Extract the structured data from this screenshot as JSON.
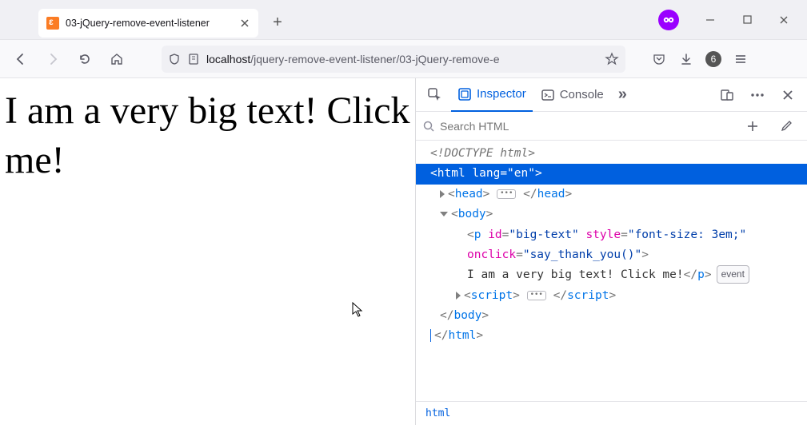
{
  "window": {
    "tab_title": "03-jQuery-remove-event-listener",
    "minimize": "—",
    "maximize": "☐",
    "close": "✕",
    "newtab_plus": "+"
  },
  "toolbar": {
    "url_host": "localhost",
    "url_path": "/jquery-remove-event-listener/03-jQuery-remove-e",
    "badge_count": "6"
  },
  "page": {
    "big_text": "I am a very big text! Click me!"
  },
  "devtools": {
    "tab_inspector": "Inspector",
    "tab_console": "Console",
    "more": "»",
    "search_placeholder": "Search HTML",
    "breadcrumb": "html",
    "tree": {
      "doctype": "<!DOCTYPE html>",
      "html_open": "<html lang=\"en\">",
      "head": "head",
      "body": "body",
      "p_id_attr": "id",
      "p_id_val": "\"big-text\"",
      "p_style_attr": "style",
      "p_style_val": "\"font-size: 3em;\"",
      "p_onclick_attr": "onclick",
      "p_onclick_val": "\"say_thank_you()\"",
      "p_text": "I am a very big text! Click me!",
      "event_label": "event",
      "script": "script",
      "html_close": "</html>"
    }
  }
}
